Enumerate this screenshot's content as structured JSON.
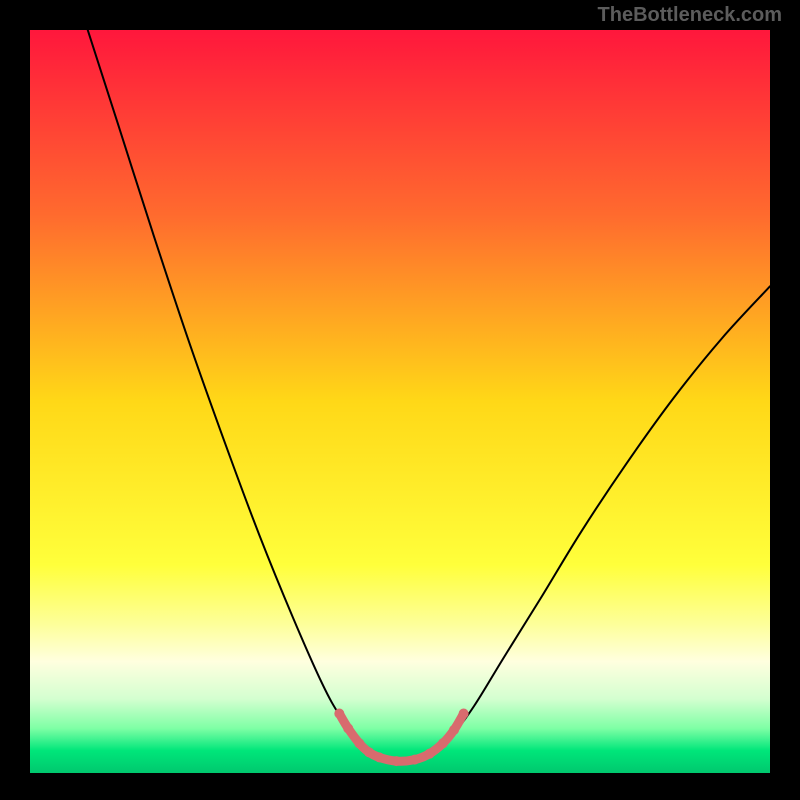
{
  "watermark": "TheBottleneck.com",
  "chart_data": {
    "type": "line",
    "title": "",
    "xlabel": "",
    "ylabel": "",
    "xlim": [
      0,
      1
    ],
    "ylim": [
      0,
      1
    ],
    "background": {
      "gradient_stops": [
        {
          "offset": 0.0,
          "color": "#ff173c"
        },
        {
          "offset": 0.25,
          "color": "#ff6b2e"
        },
        {
          "offset": 0.5,
          "color": "#ffd817"
        },
        {
          "offset": 0.72,
          "color": "#ffff3b"
        },
        {
          "offset": 0.8,
          "color": "#fdff9a"
        },
        {
          "offset": 0.85,
          "color": "#ffffdf"
        },
        {
          "offset": 0.9,
          "color": "#d4ffd0"
        },
        {
          "offset": 0.94,
          "color": "#7effa5"
        },
        {
          "offset": 0.97,
          "color": "#00e67a"
        },
        {
          "offset": 1.0,
          "color": "#00c86e"
        }
      ]
    },
    "series": [
      {
        "name": "curve",
        "color": "#000000",
        "width": 2,
        "points": [
          {
            "x": 0.078,
            "y": 1.0
          },
          {
            "x": 0.12,
            "y": 0.87
          },
          {
            "x": 0.165,
            "y": 0.73
          },
          {
            "x": 0.215,
            "y": 0.58
          },
          {
            "x": 0.265,
            "y": 0.44
          },
          {
            "x": 0.31,
            "y": 0.32
          },
          {
            "x": 0.355,
            "y": 0.21
          },
          {
            "x": 0.395,
            "y": 0.12
          },
          {
            "x": 0.42,
            "y": 0.075
          },
          {
            "x": 0.445,
            "y": 0.04
          },
          {
            "x": 0.47,
            "y": 0.022
          },
          {
            "x": 0.495,
            "y": 0.016
          },
          {
            "x": 0.52,
            "y": 0.018
          },
          {
            "x": 0.545,
            "y": 0.028
          },
          {
            "x": 0.57,
            "y": 0.05
          },
          {
            "x": 0.6,
            "y": 0.09
          },
          {
            "x": 0.64,
            "y": 0.155
          },
          {
            "x": 0.69,
            "y": 0.235
          },
          {
            "x": 0.745,
            "y": 0.325
          },
          {
            "x": 0.805,
            "y": 0.415
          },
          {
            "x": 0.87,
            "y": 0.505
          },
          {
            "x": 0.935,
            "y": 0.585
          },
          {
            "x": 1.0,
            "y": 0.655
          }
        ]
      },
      {
        "name": "valley-highlight",
        "color": "#d86b6e",
        "width": 9,
        "points": [
          {
            "x": 0.418,
            "y": 0.08
          },
          {
            "x": 0.43,
            "y": 0.06
          },
          {
            "x": 0.445,
            "y": 0.04
          },
          {
            "x": 0.458,
            "y": 0.028
          },
          {
            "x": 0.472,
            "y": 0.021
          },
          {
            "x": 0.495,
            "y": 0.016
          },
          {
            "x": 0.52,
            "y": 0.018
          },
          {
            "x": 0.54,
            "y": 0.026
          },
          {
            "x": 0.558,
            "y": 0.04
          },
          {
            "x": 0.573,
            "y": 0.058
          },
          {
            "x": 0.586,
            "y": 0.08
          }
        ]
      }
    ]
  }
}
